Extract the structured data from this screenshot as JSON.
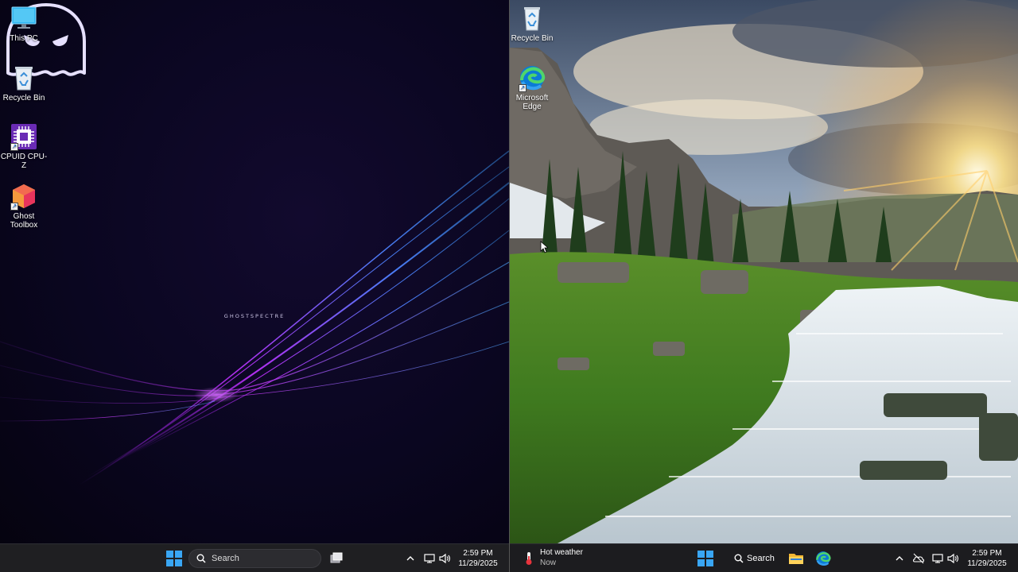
{
  "left_screen": {
    "desktop_icons": [
      {
        "label": "This PC"
      },
      {
        "label": "Recycle Bin"
      },
      {
        "label": "CPUID CPU-Z"
      },
      {
        "label": "Ghost Toolbox"
      }
    ],
    "wallpaper_logo_text": "GHOSTSPECTRE",
    "taskbar": {
      "search_placeholder": "Search",
      "clock_time": "2:59 PM",
      "clock_date": "11/29/2025"
    }
  },
  "right_screen": {
    "desktop_icons": [
      {
        "label": "Recycle Bin"
      },
      {
        "label": "Microsoft Edge"
      }
    ],
    "taskbar": {
      "weather_title": "Hot weather",
      "weather_subtitle": "Now",
      "search_label": "Search",
      "clock_time": "2:59 PM",
      "clock_date": "11/29/2025"
    }
  },
  "colors": {
    "accent_start": "#39a6f4",
    "taskbar_bg": "#1f1f22",
    "left_wallpaper_bg": "#0a0620"
  },
  "icons": [
    "monitor-icon",
    "recycle-bin-icon",
    "cpu-z-icon",
    "ghost-toolbox-icon",
    "edge-icon",
    "windows-start-icon",
    "search-icon",
    "task-view-icon",
    "chevron-up-icon",
    "network-icon",
    "volume-icon",
    "thermometer-icon",
    "file-explorer-icon",
    "onedrive-icon"
  ]
}
